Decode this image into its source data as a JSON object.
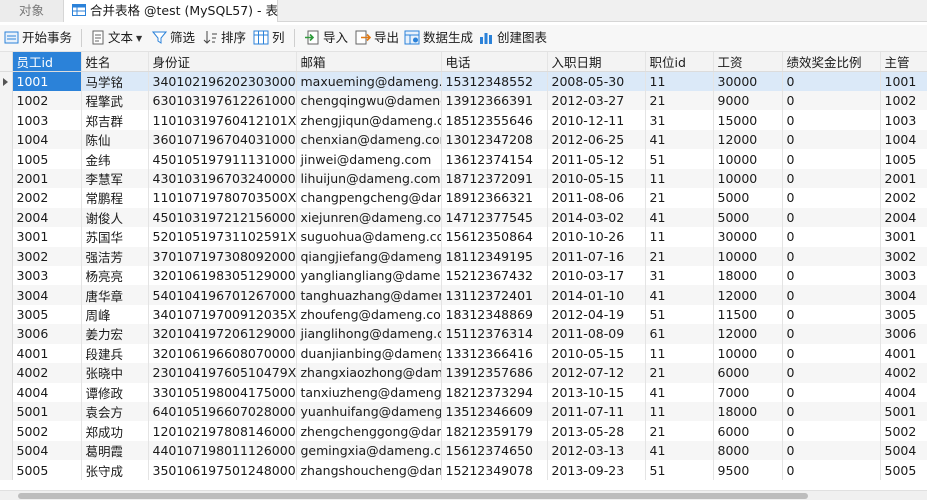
{
  "tabs": {
    "objects_label": "对象",
    "active_label": "合并表格 @test (MySQL57) - 表"
  },
  "toolbar": {
    "begin_transaction": "开始事务",
    "text": "文本",
    "filter": "筛选",
    "sort": "排序",
    "columns": "列",
    "import": "导入",
    "export": "导出",
    "data_generation": "数据生成",
    "create_chart": "创建图表"
  },
  "colors": {
    "accent": "#2b82d9",
    "selected_row": "#dbe9f8"
  },
  "table": {
    "columns": [
      "员工id",
      "姓名",
      "身份证",
      "邮箱",
      "电话",
      "入职日期",
      "职位id",
      "工资",
      "绩效奖金比例",
      "主管"
    ],
    "rows": [
      [
        "1001",
        "马学铭",
        "340102196202303000",
        "maxueming@dameng.com",
        "15312348552",
        "2008-05-30",
        "11",
        "30000",
        "0",
        "1001"
      ],
      [
        "1002",
        "程擎武",
        "630103197612261000",
        "chengqingwu@dameng.com",
        "13912366391",
        "2012-03-27",
        "21",
        "9000",
        "0",
        "1002"
      ],
      [
        "1003",
        "郑吉群",
        "11010319760412101X",
        "zhengjiqun@dameng.com",
        "18512355646",
        "2010-12-11",
        "31",
        "15000",
        "0",
        "1003"
      ],
      [
        "1004",
        "陈仙",
        "360107196704031000",
        "chenxian@dameng.com",
        "13012347208",
        "2012-06-25",
        "41",
        "12000",
        "0",
        "1004"
      ],
      [
        "1005",
        "金纬",
        "450105197911131000",
        "jinwei@dameng.com",
        "13612374154",
        "2011-05-12",
        "51",
        "10000",
        "0",
        "1005"
      ],
      [
        "2001",
        "李慧军",
        "430103196703240000",
        "lihuijun@dameng.com",
        "18712372091",
        "2010-05-15",
        "11",
        "10000",
        "0",
        "2001"
      ],
      [
        "2002",
        "常鹏程",
        "11010719780703500X",
        "changpengcheng@dameng.com",
        "18912366321",
        "2011-08-06",
        "21",
        "5000",
        "0",
        "2002"
      ],
      [
        "2004",
        "谢俊人",
        "450103197212156000",
        "xiejunren@dameng.com",
        "14712377545",
        "2014-03-02",
        "41",
        "5000",
        "0",
        "2004"
      ],
      [
        "3001",
        "苏国华",
        "52010519731102591X",
        "suguohua@dameng.com",
        "15612350864",
        "2010-10-26",
        "11",
        "30000",
        "0",
        "3001"
      ],
      [
        "3002",
        "强洁芳",
        "370107197308092000",
        "qiangjiefang@dameng.com",
        "18112349195",
        "2011-07-16",
        "21",
        "10000",
        "0",
        "3002"
      ],
      [
        "3003",
        "杨亮亮",
        "320106198305129000",
        "yangliangliang@dameng.com",
        "15212367432",
        "2010-03-17",
        "31",
        "18000",
        "0",
        "3003"
      ],
      [
        "3004",
        "唐华章",
        "540104196701267000",
        "tanghuazhang@dameng.com",
        "13112372401",
        "2014-01-10",
        "41",
        "12000",
        "0",
        "3004"
      ],
      [
        "3005",
        "周峰",
        "34010719700912035X",
        "zhoufeng@dameng.com",
        "18312348869",
        "2012-04-19",
        "51",
        "11500",
        "0",
        "3005"
      ],
      [
        "3006",
        "姜力宏",
        "320104197206129000",
        "jianglihong@dameng.com",
        "15112376314",
        "2011-08-09",
        "61",
        "12000",
        "0",
        "3006"
      ],
      [
        "4001",
        "段建兵",
        "320106196608070000",
        "duanjianbing@dameng.com",
        "13312366416",
        "2010-05-15",
        "11",
        "10000",
        "0",
        "4001"
      ],
      [
        "4002",
        "张晓中",
        "23010419760510479X",
        "zhangxiaozhong@dameng.com",
        "13912357686",
        "2012-07-12",
        "21",
        "6000",
        "0",
        "4002"
      ],
      [
        "4004",
        "谭修政",
        "330105198004175000",
        "tanxiuzheng@dameng.com",
        "18212373294",
        "2013-10-15",
        "41",
        "7000",
        "0",
        "4004"
      ],
      [
        "5001",
        "袁会方",
        "640105196607028000",
        "yuanhuifang@dameng.com",
        "13512346609",
        "2011-07-11",
        "11",
        "18000",
        "0",
        "5001"
      ],
      [
        "5002",
        "郑成功",
        "120102197808146000",
        "zhengchenggong@dameng.com",
        "18212359179",
        "2013-05-28",
        "21",
        "6000",
        "0",
        "5002"
      ],
      [
        "5004",
        "葛明霞",
        "440107198011126000",
        "gemingxia@dameng.com",
        "15612374650",
        "2012-03-13",
        "41",
        "8000",
        "0",
        "5004"
      ],
      [
        "5005",
        "张守成",
        "350106197501248000",
        "zhangshoucheng@dameng.com",
        "15212349078",
        "2013-09-23",
        "51",
        "9500",
        "0",
        "5005"
      ]
    ]
  }
}
